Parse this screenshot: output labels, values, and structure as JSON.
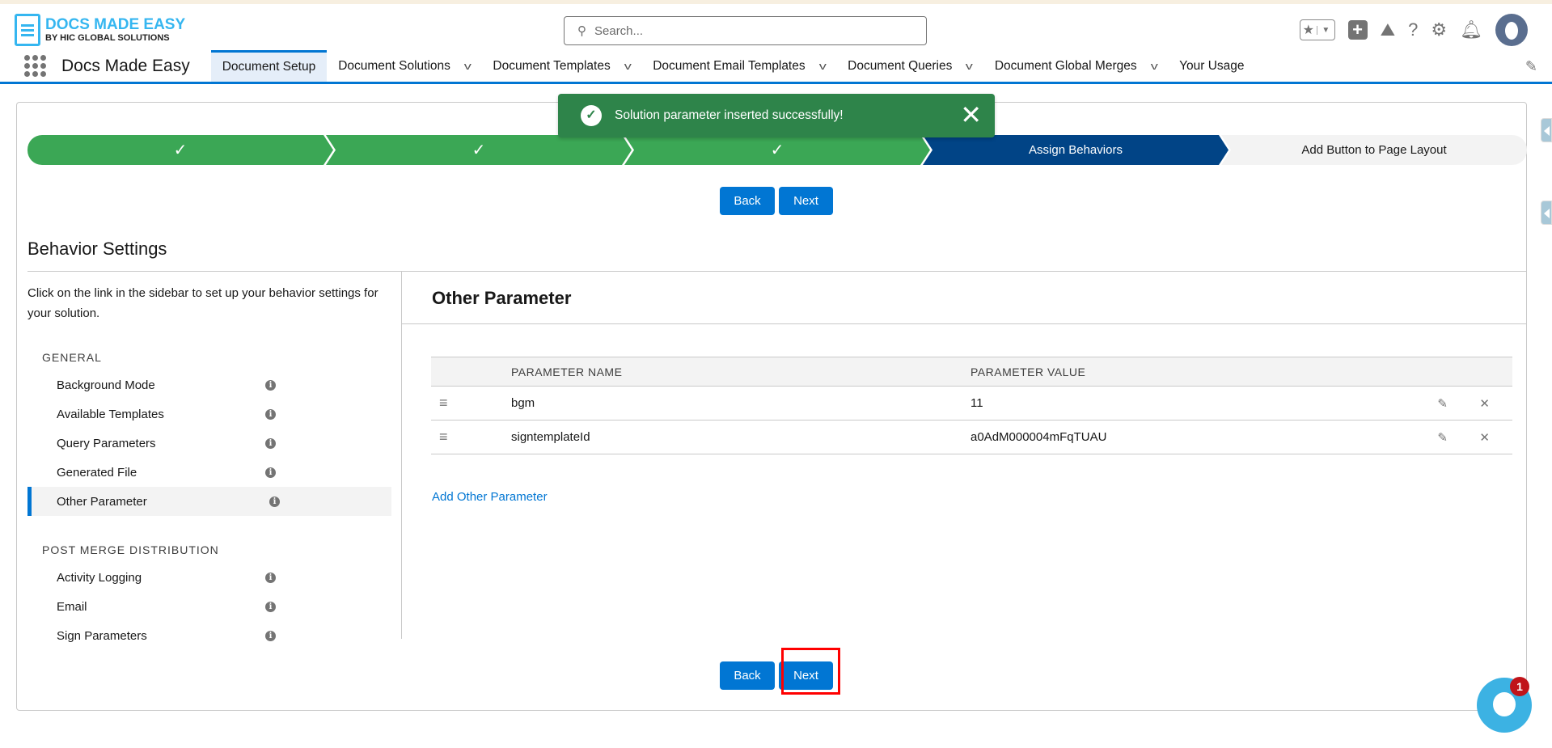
{
  "header": {
    "logo_title": "DOCS MADE EASY",
    "logo_subtitle": "BY HIC GLOBAL SOLUTIONS",
    "search_placeholder": "Search..."
  },
  "nav": {
    "app_name": "Docs Made Easy",
    "items": [
      {
        "label": "Document Setup",
        "active": true,
        "dropdown": false
      },
      {
        "label": "Document Solutions",
        "dropdown": true
      },
      {
        "label": "Document Templates",
        "dropdown": true
      },
      {
        "label": "Document Email Templates",
        "dropdown": true
      },
      {
        "label": "Document Queries",
        "dropdown": true
      },
      {
        "label": "Document Global Merges",
        "dropdown": true
      },
      {
        "label": "Your Usage",
        "dropdown": false
      }
    ]
  },
  "toast": {
    "message": "Solution parameter inserted successfully!",
    "type": "success"
  },
  "path": {
    "steps": [
      {
        "label": "✓",
        "status": "complete"
      },
      {
        "label": "✓",
        "status": "complete"
      },
      {
        "label": "✓",
        "status": "complete"
      },
      {
        "label": "Assign Behaviors",
        "status": "current"
      },
      {
        "label": "Add Button to Page Layout",
        "status": "incomplete"
      }
    ]
  },
  "buttons": {
    "back": "Back",
    "next": "Next"
  },
  "behavior": {
    "title": "Behavior Settings",
    "intro": "Click on the link in the sidebar to set up your behavior settings for your solution.",
    "sections": [
      {
        "title": "GENERAL",
        "items": [
          "Background Mode",
          "Available Templates",
          "Query Parameters",
          "Generated File",
          "Other Parameter"
        ]
      },
      {
        "title": "POST MERGE DISTRIBUTION",
        "items": [
          "Activity Logging",
          "Email",
          "Sign Parameters"
        ]
      }
    ],
    "selected": "Other Parameter"
  },
  "panel": {
    "title": "Other Parameter",
    "columns": [
      "PARAMETER NAME",
      "PARAMETER VALUE"
    ],
    "rows": [
      {
        "name": "bgm",
        "value": "11"
      },
      {
        "name": "signtemplateId",
        "value": "a0AdM000004mFqTUAU"
      }
    ],
    "add_link": "Add Other Parameter"
  },
  "chat": {
    "badge_count": "1"
  },
  "colors": {
    "brand": "#0176d3",
    "success": "#2e844a",
    "path_complete": "#3ba755",
    "path_current": "#014486"
  }
}
